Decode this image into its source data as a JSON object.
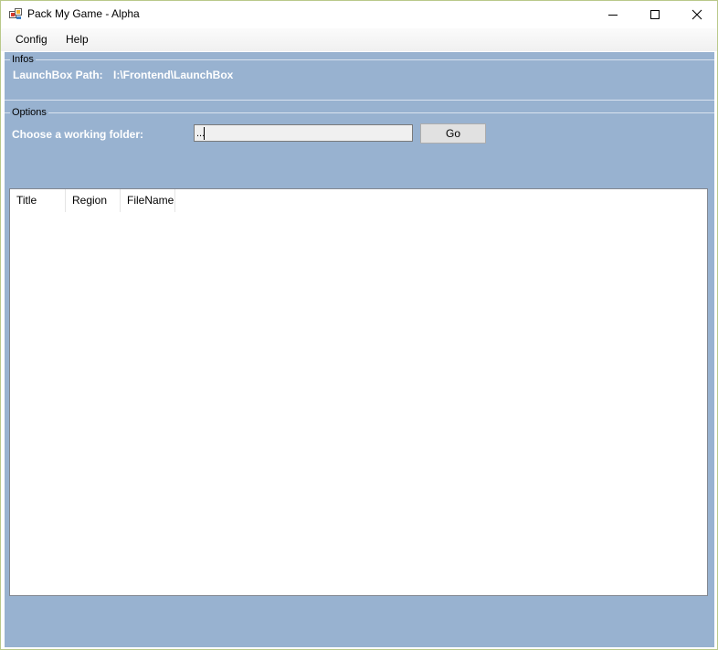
{
  "window": {
    "title": "Pack My Game - Alpha",
    "icon": "app-icon",
    "controls": [
      "minimize-icon",
      "maximize-icon",
      "close-icon"
    ]
  },
  "menu": {
    "items": [
      {
        "label": "Config"
      },
      {
        "label": "Help"
      }
    ]
  },
  "infos": {
    "legend": "Infos",
    "launchbox_label": "LaunchBox Path:",
    "launchbox_value": "I:\\Frontend\\LaunchBox"
  },
  "options": {
    "legend": "Options",
    "folder_label": "Choose a working folder:",
    "folder_value": "...",
    "go_label": "Go"
  },
  "list": {
    "columns": [
      "Title",
      "Region",
      "FileName"
    ],
    "rows": []
  },
  "colors": {
    "client_background": "#98b2d0",
    "label_text": "#ffffff"
  }
}
